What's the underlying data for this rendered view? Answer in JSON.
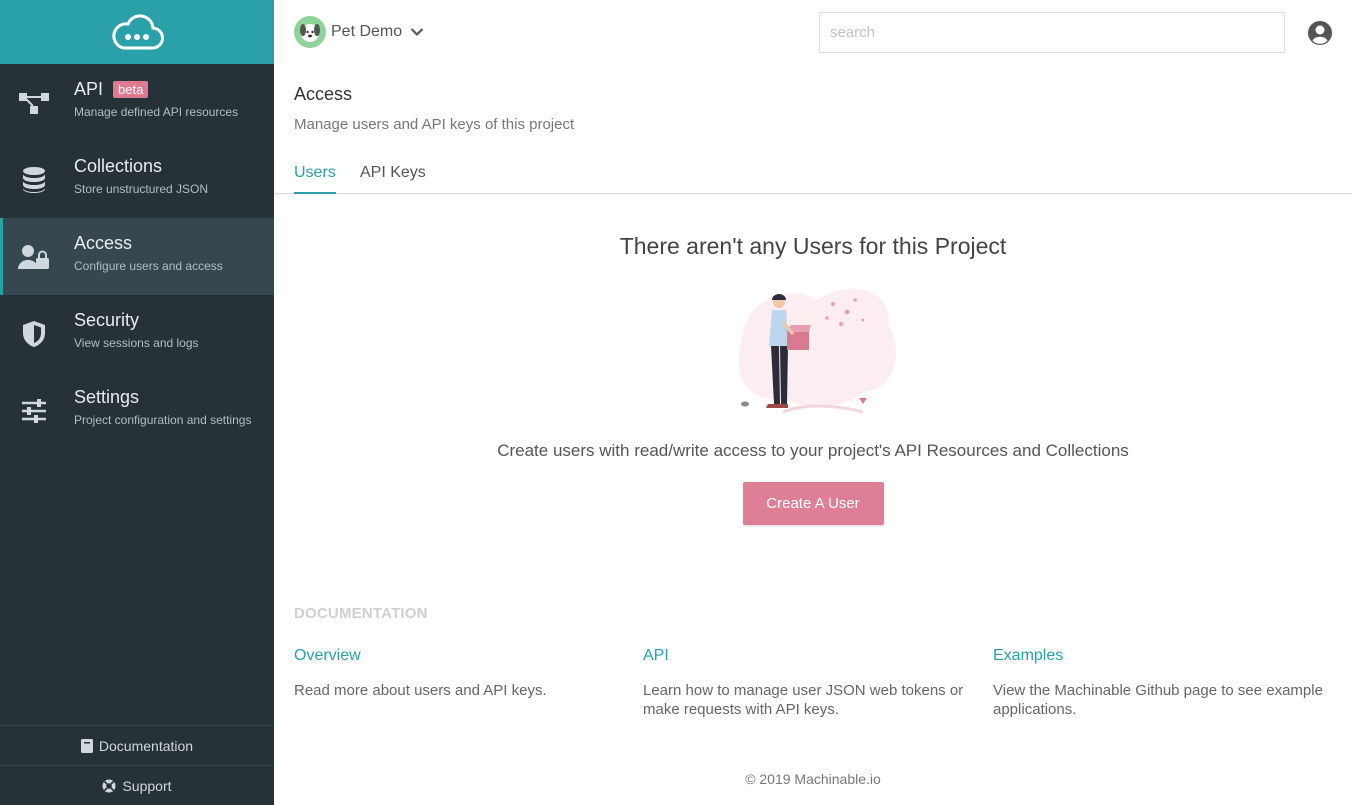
{
  "sidebar": {
    "items": [
      {
        "title": "API",
        "badge": "beta",
        "subtitle": "Manage defined API resources",
        "icon": "api-icon"
      },
      {
        "title": "Collections",
        "subtitle": "Store unstructured JSON",
        "icon": "database-icon"
      },
      {
        "title": "Access",
        "subtitle": "Configure users and access",
        "icon": "user-lock-icon"
      },
      {
        "title": "Security",
        "subtitle": "View sessions and logs",
        "icon": "shield-icon"
      },
      {
        "title": "Settings",
        "subtitle": "Project configuration and settings",
        "icon": "sliders-icon"
      }
    ],
    "documentation_label": "Documentation",
    "support_label": "Support"
  },
  "topbar": {
    "project_name": "Pet Demo",
    "search_placeholder": "search"
  },
  "page": {
    "title": "Access",
    "subtitle": "Manage users and API keys of this project",
    "tabs": [
      "Users",
      "API Keys"
    ],
    "active_tab": "Users"
  },
  "empty_state": {
    "title": "There aren't any Users for this Project",
    "description": "Create users with read/write access to your project's API Resources and Collections",
    "button_label": "Create A User"
  },
  "docs": {
    "heading": "DOCUMENTATION",
    "links": [
      {
        "title": "Overview",
        "description": "Read more about users and API keys."
      },
      {
        "title": "API",
        "description": "Learn how to manage user JSON web tokens or make requests with API keys."
      },
      {
        "title": "Examples",
        "description": "View the Machinable Github page to see example applications."
      }
    ]
  },
  "footer": "© 2019 Machinable.io",
  "colors": {
    "accent": "#2aa0a8",
    "sidebar_bg": "#263238",
    "button": "#df7f96"
  }
}
